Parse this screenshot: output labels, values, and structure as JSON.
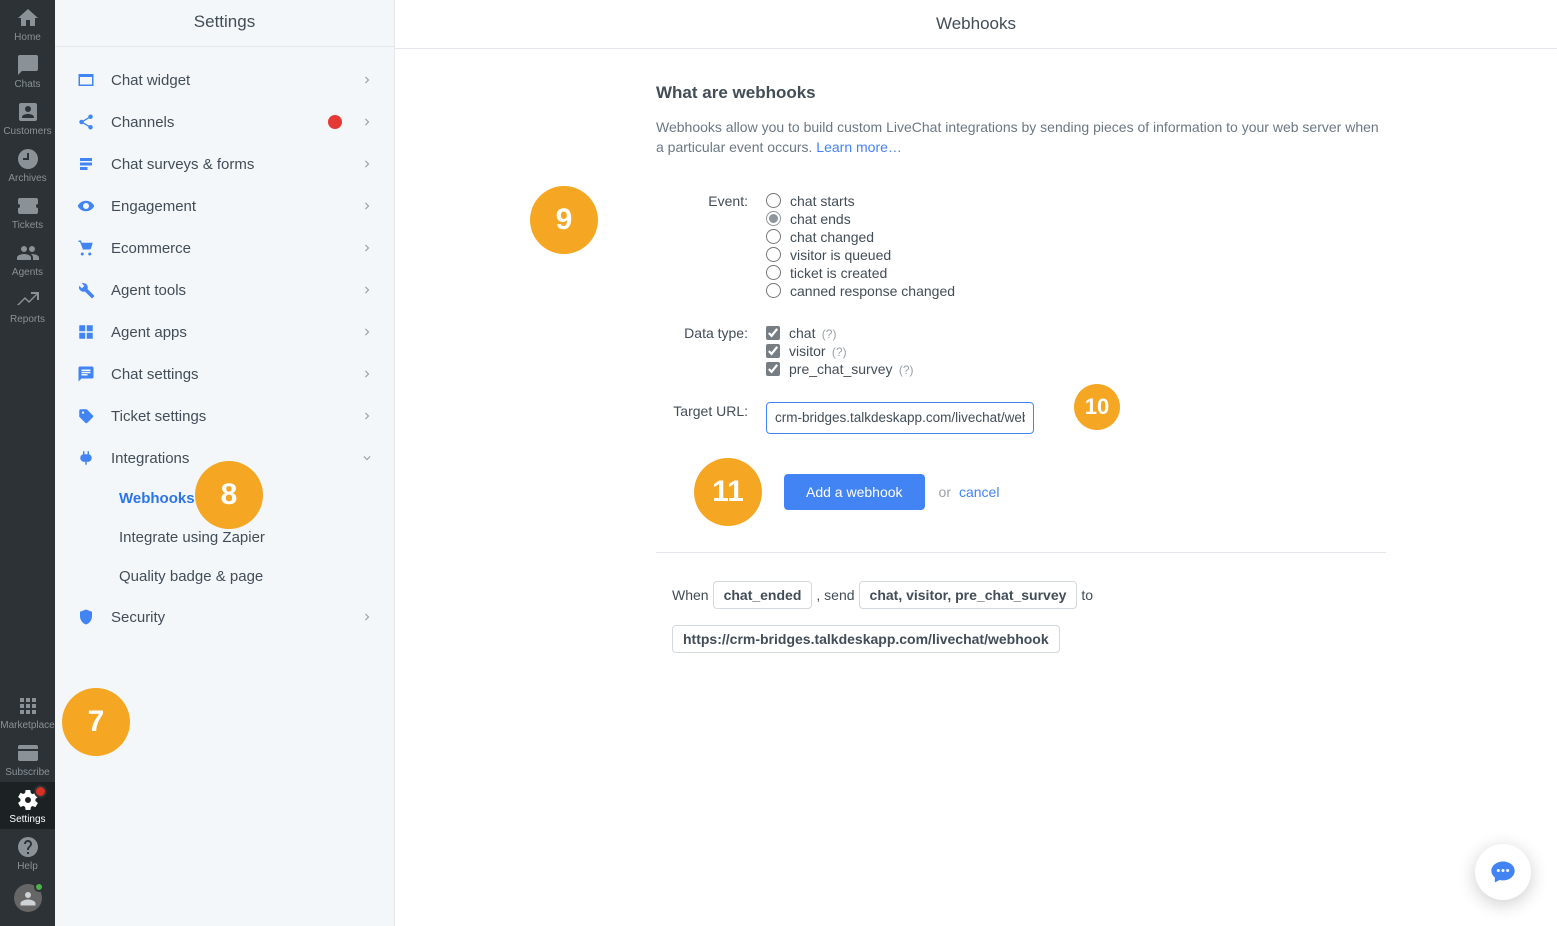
{
  "rail": {
    "items_top": [
      {
        "icon": "home",
        "label": "Home",
        "active": false
      },
      {
        "icon": "chat",
        "label": "Chats",
        "active": false
      },
      {
        "icon": "contact",
        "label": "Customers",
        "active": false
      },
      {
        "icon": "clock",
        "label": "Archives",
        "active": false
      },
      {
        "icon": "ticket",
        "label": "Tickets",
        "active": false
      },
      {
        "icon": "people",
        "label": "Agents",
        "active": false
      },
      {
        "icon": "trend",
        "label": "Reports",
        "active": false
      }
    ],
    "items_bottom": [
      {
        "icon": "apps",
        "label": "Marketplace",
        "active": false
      },
      {
        "icon": "card",
        "label": "Subscribe",
        "active": false
      },
      {
        "icon": "gear",
        "label": "Settings",
        "active": true,
        "badge": true
      },
      {
        "icon": "help",
        "label": "Help",
        "active": false
      }
    ]
  },
  "sidebar": {
    "title": "Settings",
    "items": [
      {
        "icon": "widget",
        "label": "Chat widget"
      },
      {
        "icon": "share",
        "label": "Channels",
        "alert": true
      },
      {
        "icon": "form",
        "label": "Chat surveys & forms"
      },
      {
        "icon": "eye",
        "label": "Engagement"
      },
      {
        "icon": "cart",
        "label": "Ecommerce"
      },
      {
        "icon": "wrench",
        "label": "Agent tools"
      },
      {
        "icon": "grid",
        "label": "Agent apps"
      },
      {
        "icon": "msg",
        "label": "Chat settings"
      },
      {
        "icon": "tag",
        "label": "Ticket settings"
      },
      {
        "icon": "plug",
        "label": "Integrations",
        "expanded": true,
        "sub": [
          {
            "label": "Webhooks",
            "active": true
          },
          {
            "label": "Integrate using Zapier"
          },
          {
            "label": "Quality badge & page"
          }
        ]
      },
      {
        "icon": "shield",
        "label": "Security"
      }
    ]
  },
  "main": {
    "header": "Webhooks",
    "h2": "What are webhooks",
    "desc": "Webhooks allow you to build custom LiveChat integrations by sending pieces of information to your web server when a particular event occurs. ",
    "learn": "Learn more…",
    "form": {
      "event_label": "Event:",
      "events": [
        {
          "label": "chat starts",
          "checked": false
        },
        {
          "label": "chat ends",
          "checked": true
        },
        {
          "label": "chat changed",
          "checked": false
        },
        {
          "label": "visitor is queued",
          "checked": false
        },
        {
          "label": "ticket is created",
          "checked": false
        },
        {
          "label": "canned response changed",
          "checked": false
        }
      ],
      "datatype_label": "Data type:",
      "datatypes": [
        {
          "label": "chat",
          "hint": "(?)",
          "checked": true
        },
        {
          "label": "visitor",
          "hint": "(?)",
          "checked": true
        },
        {
          "label": "pre_chat_survey",
          "hint": "(?)",
          "checked": true
        }
      ],
      "target_label": "Target URL:",
      "target_value": "crm-bridges.talkdeskapp.com/livechat/webhook",
      "submit": "Add a webhook",
      "or": "or",
      "cancel": "cancel"
    },
    "summary": {
      "when": "When",
      "event_pill": "chat_ended",
      "send": ", send",
      "data_pill": "chat, visitor, pre_chat_survey",
      "to": "to",
      "url_pill": "https://crm-bridges.talkdeskapp.com/livechat/webhook"
    }
  },
  "annotations": {
    "a7": "7",
    "a8": "8",
    "a9": "9",
    "a10": "10",
    "a11": "11"
  }
}
